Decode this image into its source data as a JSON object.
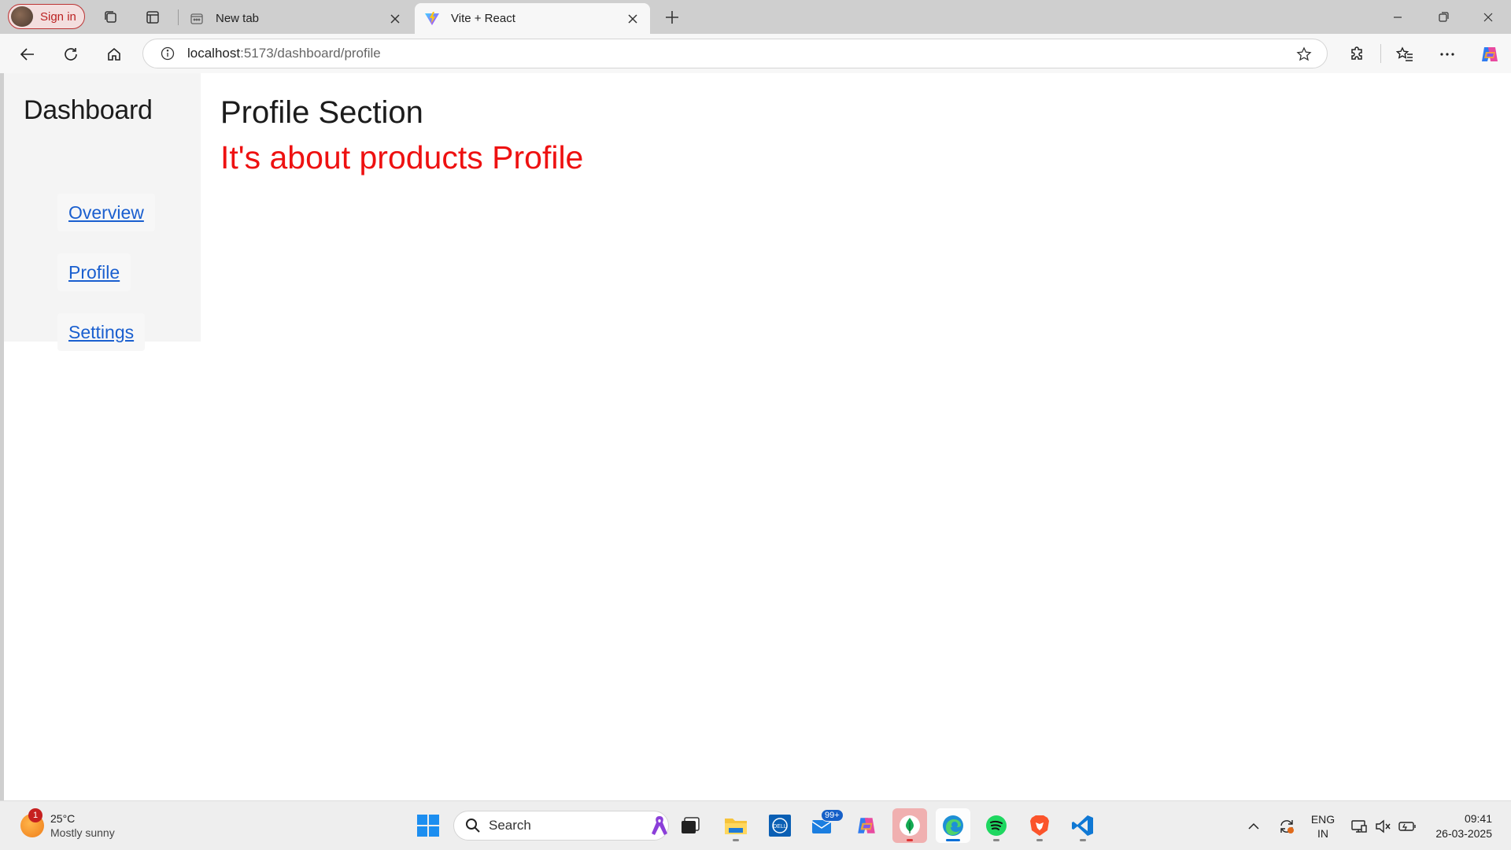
{
  "browser": {
    "signin_label": "Sign in",
    "tabs": [
      {
        "title": "New tab",
        "icon": "new-tab-page-icon",
        "active": false
      },
      {
        "title": "Vite + React",
        "icon": "vite-logo-icon",
        "active": true
      }
    ],
    "address": {
      "host": "localhost",
      "path": ":5173/dashboard/profile"
    }
  },
  "page": {
    "sidebar": {
      "title": "Dashboard",
      "links": [
        {
          "label": "Overview"
        },
        {
          "label": "Profile"
        },
        {
          "label": "Settings"
        }
      ]
    },
    "heading": "Profile Section",
    "subheading": "It's about products Profile",
    "colors": {
      "link": "#1a5fcf",
      "subheading": "#ee1111"
    }
  },
  "taskbar": {
    "weather": {
      "badge": "1",
      "temp": "25°C",
      "condition": "Mostly sunny"
    },
    "search_placeholder": "Search",
    "mail_badge": "99+",
    "language": {
      "line1": "ENG",
      "line2": "IN"
    },
    "clock": {
      "time": "09:41",
      "date": "26-03-2025"
    }
  }
}
